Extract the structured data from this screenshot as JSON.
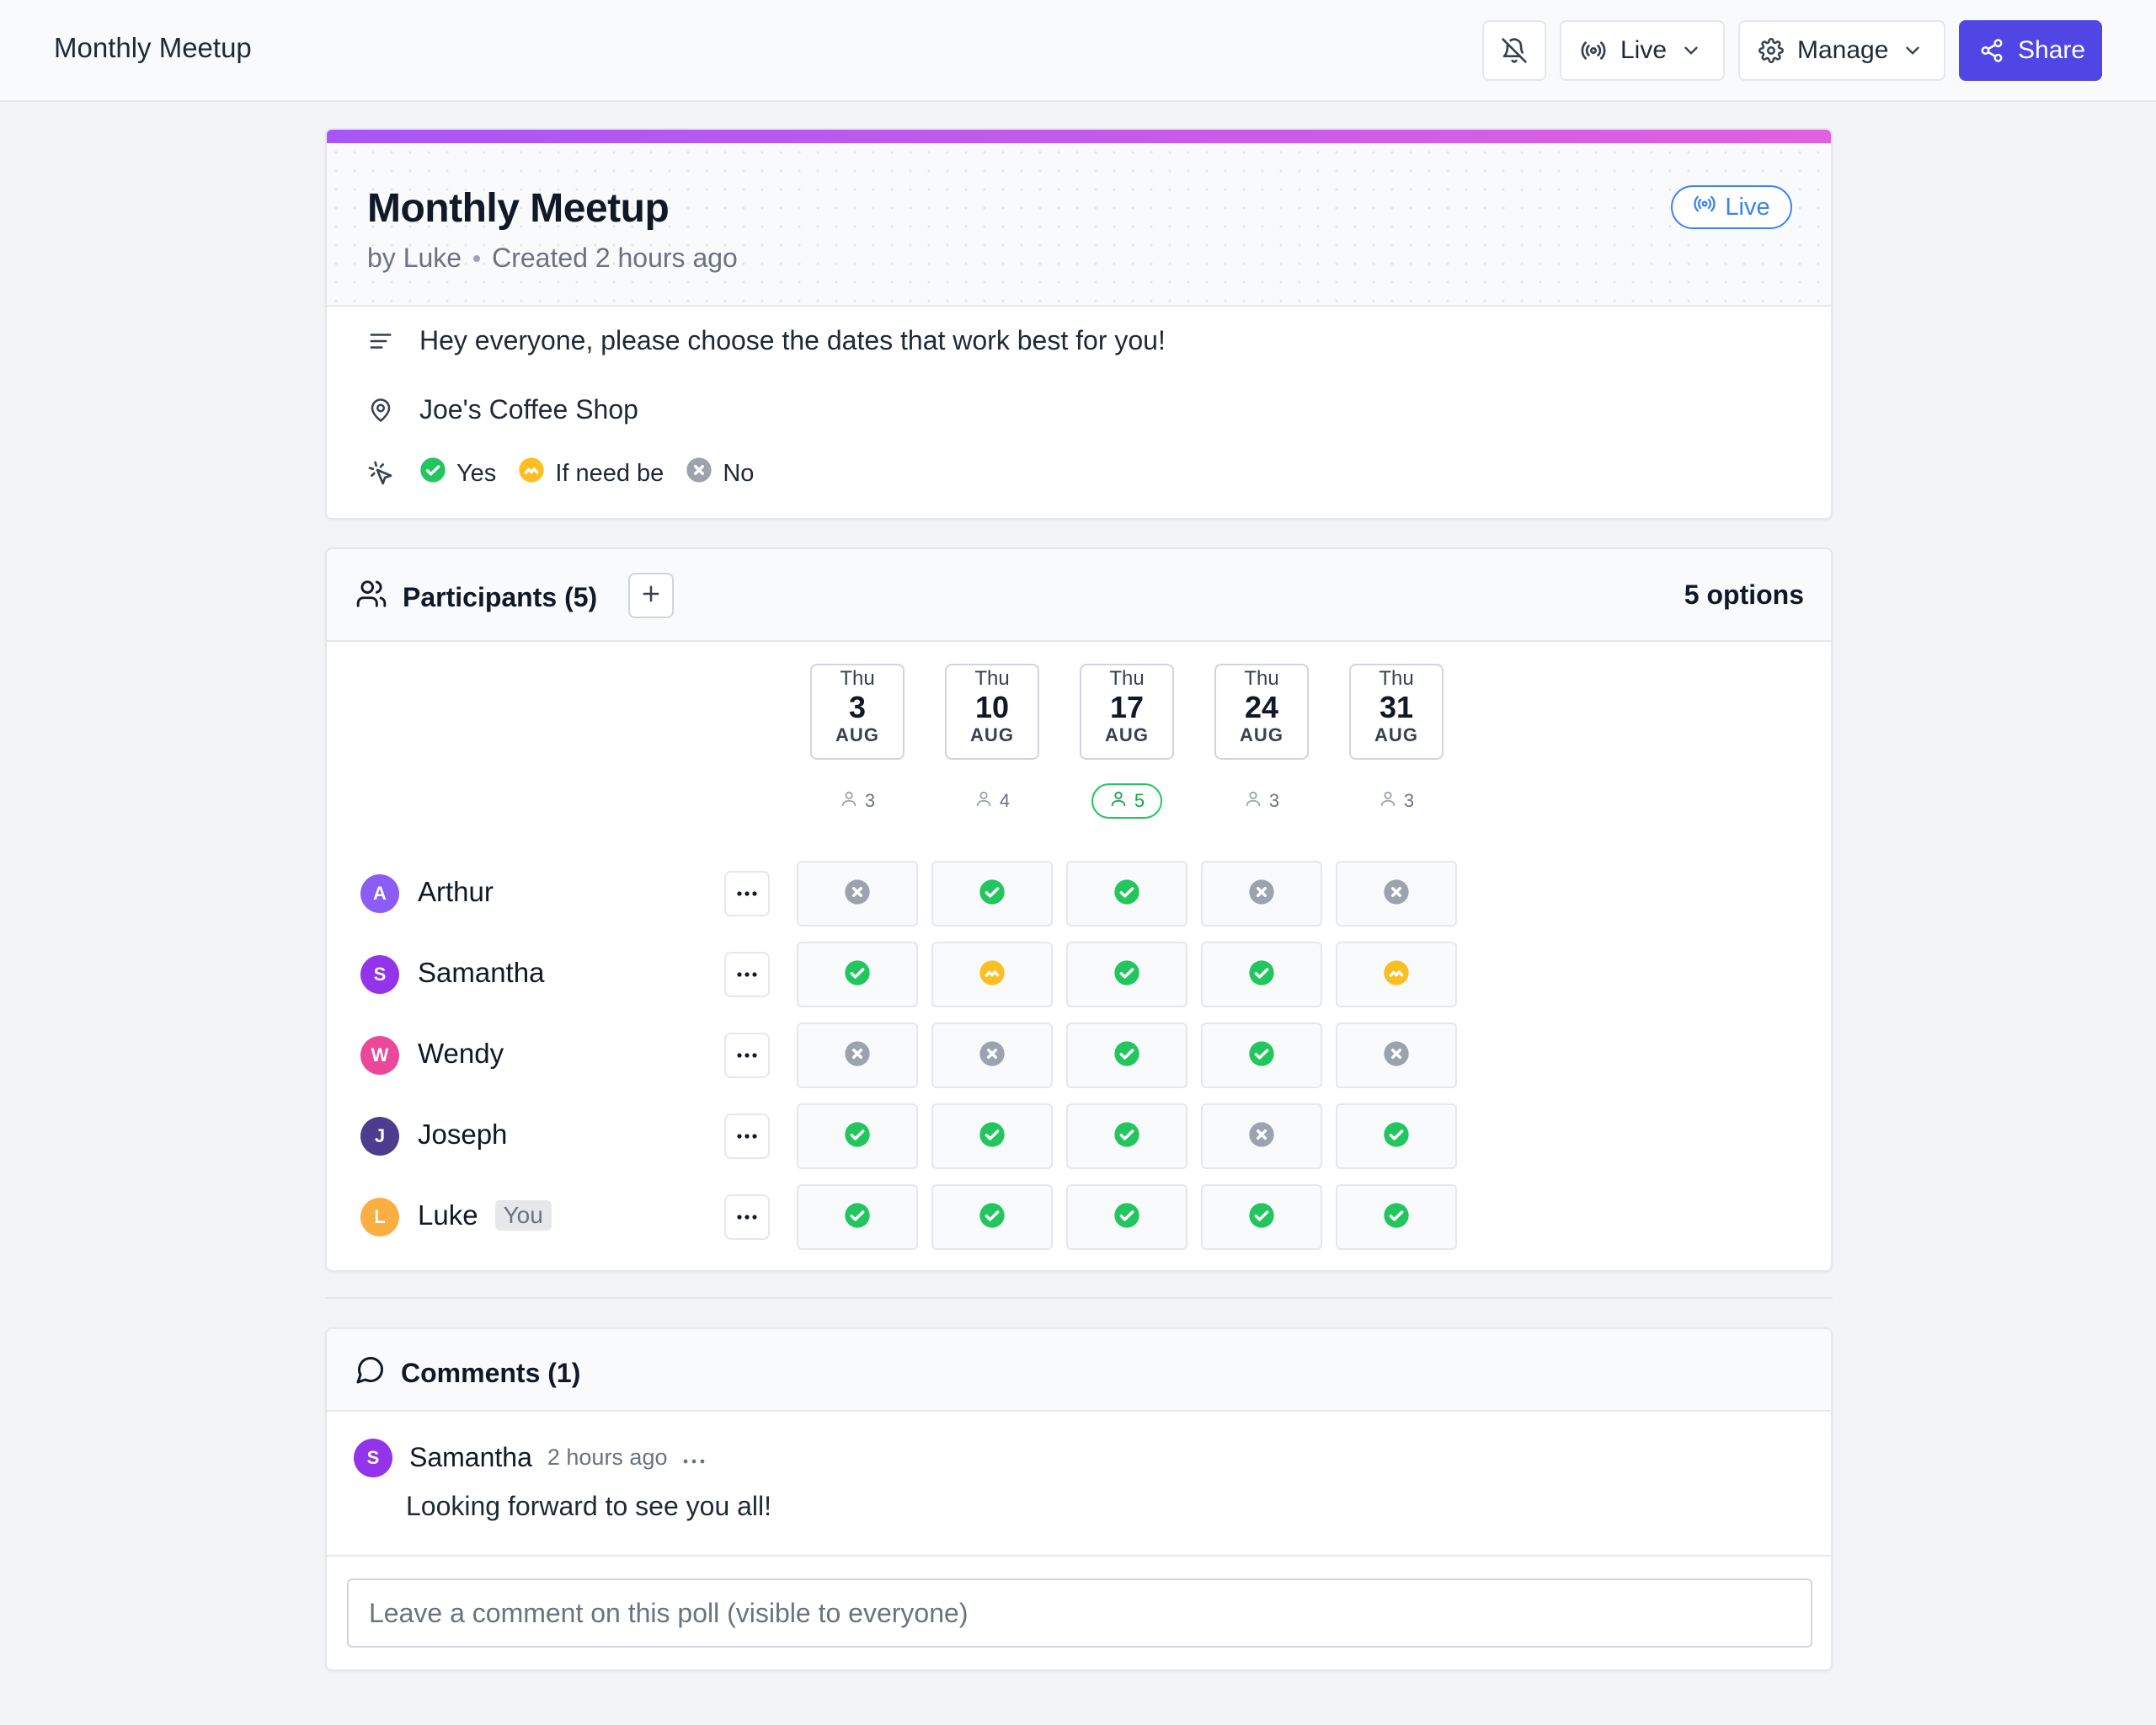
{
  "topbar": {
    "title": "Monthly Meetup",
    "live_label": "Live",
    "manage_label": "Manage",
    "share_label": "Share"
  },
  "poll": {
    "title": "Monthly Meetup",
    "author": "by Luke",
    "created": "Created 2 hours ago",
    "status": "Live",
    "description": "Hey everyone, please choose the dates that work best for you!",
    "location": "Joe's Coffee Shop",
    "legend": {
      "yes": "Yes",
      "ifneedbe": "If need be",
      "no": "No"
    }
  },
  "participants": {
    "title": "Participants (5)",
    "options_count": "5 options",
    "dates": [
      {
        "dow": "Thu",
        "day": "3",
        "month": "AUG",
        "count": "3"
      },
      {
        "dow": "Thu",
        "day": "10",
        "month": "AUG",
        "count": "4"
      },
      {
        "dow": "Thu",
        "day": "17",
        "month": "AUG",
        "count": "5"
      },
      {
        "dow": "Thu",
        "day": "24",
        "month": "AUG",
        "count": "3"
      },
      {
        "dow": "Thu",
        "day": "31",
        "month": "AUG",
        "count": "3"
      }
    ],
    "rows": [
      {
        "initial": "A",
        "name": "Arthur",
        "color": "#8b5cf6",
        "votes": [
          "no",
          "yes",
          "yes",
          "no",
          "no"
        ]
      },
      {
        "initial": "S",
        "name": "Samantha",
        "color": "#9333ea",
        "votes": [
          "yes",
          "ifneedbe",
          "yes",
          "yes",
          "ifneedbe"
        ]
      },
      {
        "initial": "W",
        "name": "Wendy",
        "color": "#ec4899",
        "votes": [
          "no",
          "no",
          "yes",
          "yes",
          "no"
        ]
      },
      {
        "initial": "J",
        "name": "Joseph",
        "color": "#4c3d8f",
        "votes": [
          "yes",
          "yes",
          "yes",
          "no",
          "yes"
        ]
      },
      {
        "initial": "L",
        "name": "Luke",
        "color": "#fbae42",
        "tag": "You",
        "votes": [
          "yes",
          "yes",
          "yes",
          "yes",
          "yes"
        ]
      }
    ]
  },
  "comments": {
    "title": "Comments (1)",
    "items": [
      {
        "initial": "S",
        "author": "Samantha",
        "time": "2 hours ago",
        "text": "Looking forward to see you all!"
      }
    ],
    "placeholder": "Leave a comment on this poll (visible to everyone)"
  },
  "colors": {
    "accent": "#4f46e5",
    "yes": "#22c55e",
    "ifneedbe": "#fbbf24",
    "no": "#9ca3af",
    "live": "#3b82f6"
  }
}
